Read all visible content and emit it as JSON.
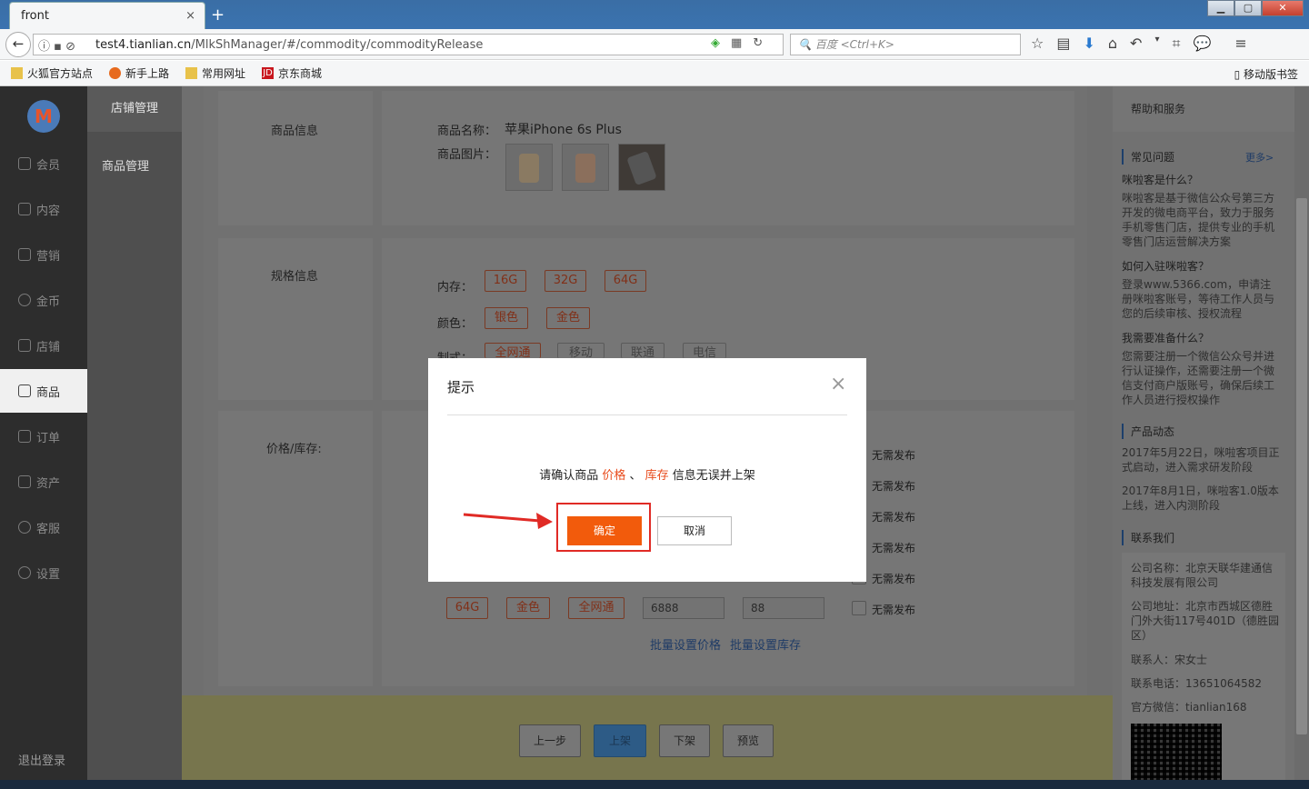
{
  "browser": {
    "tab_title": "front",
    "tab_close": "×",
    "new_tab": "+",
    "url_host": "test4.tianlian.cn",
    "url_path": "/MlkShManager/#/commodity/commodityRelease",
    "search_placeholder": "百度 <Ctrl+K>",
    "bookmarks": [
      "火狐官方站点",
      "新手上路",
      "常用网址",
      "京东商城"
    ],
    "mobile_bookmarks": "移动版书签"
  },
  "sidebar": {
    "logo": "M",
    "items": [
      "会员",
      "内容",
      "营销",
      "金币",
      "店铺",
      "商品",
      "订单",
      "资产",
      "客服",
      "设置"
    ],
    "active": "商品",
    "logout": "退出登录"
  },
  "subnav": {
    "header": "店铺管理",
    "item": "商品管理"
  },
  "product": {
    "info_label": "商品信息",
    "name_label": "商品名称：",
    "name_value": "苹果iPhone 6s Plus",
    "images_label": "商品图片："
  },
  "spec": {
    "label": "规格信息",
    "memory_label": "内存：",
    "memory": [
      "16G",
      "32G",
      "64G"
    ],
    "color_label": "颜色：",
    "colors": [
      "银色",
      "金色"
    ],
    "network_label": "制式：",
    "network": [
      "全网通",
      "移动",
      "联通",
      "电信"
    ]
  },
  "price": {
    "label": "价格/库存:",
    "no_publish": "无需发布",
    "last_row": {
      "memory": "64G",
      "color": "金色",
      "network": "全网通",
      "price": "6888",
      "stock": "88"
    },
    "batch_price": "批量设置价格",
    "batch_stock": "批量设置库存"
  },
  "footer": {
    "prev": "上一步",
    "publish": "上架",
    "unpublish": "下架",
    "preview": "预览"
  },
  "help": {
    "header": "帮助和服务",
    "faq_title": "常见问题",
    "more": "更多>",
    "q1": "咪啦客是什么？",
    "a1": "咪啦客是基于微信公众号第三方开发的微电商平台，致力于服务手机零售门店，提供专业的手机零售门店运营解决方案",
    "q2": "如何入驻咪啦客？",
    "a2": "登录www.5366.com，申请注册咪啦客账号，等待工作人员与您的后续审核、授权流程",
    "q3": "我需要准备什么？",
    "a3": "您需要注册一个微信公众号并进行认证操作，还需要注册一个微信支付商户版账号，确保后续工作人员进行授权操作",
    "news_title": "产品动态",
    "news1": "2017年5月22日，咪啦客项目正式启动，进入需求研发阶段",
    "news2": "2017年8月1日，咪啦客1.0版本上线，进入内测阶段",
    "contact_title": "联系我们",
    "company": "公司名称：北京天联华建通信科技发展有限公司",
    "address": "公司地址：北京市西城区德胜门外大街117号401D（德胜园区）",
    "contact_person": "联系人：宋女士",
    "phone": "联系电话：13651064582",
    "wechat": "官方微信：tianlian168"
  },
  "modal": {
    "title": "提示",
    "close": "×",
    "msg_pre": "请确认商品 ",
    "msg_price": "价格",
    "msg_sep": " 、 ",
    "msg_stock": "库存",
    "msg_post": " 信息无误并上架",
    "ok": "确定",
    "cancel": "取消"
  },
  "colors": {
    "accent": "#f25b0c",
    "highlight": "#e02a25",
    "link": "#1e3b66"
  }
}
